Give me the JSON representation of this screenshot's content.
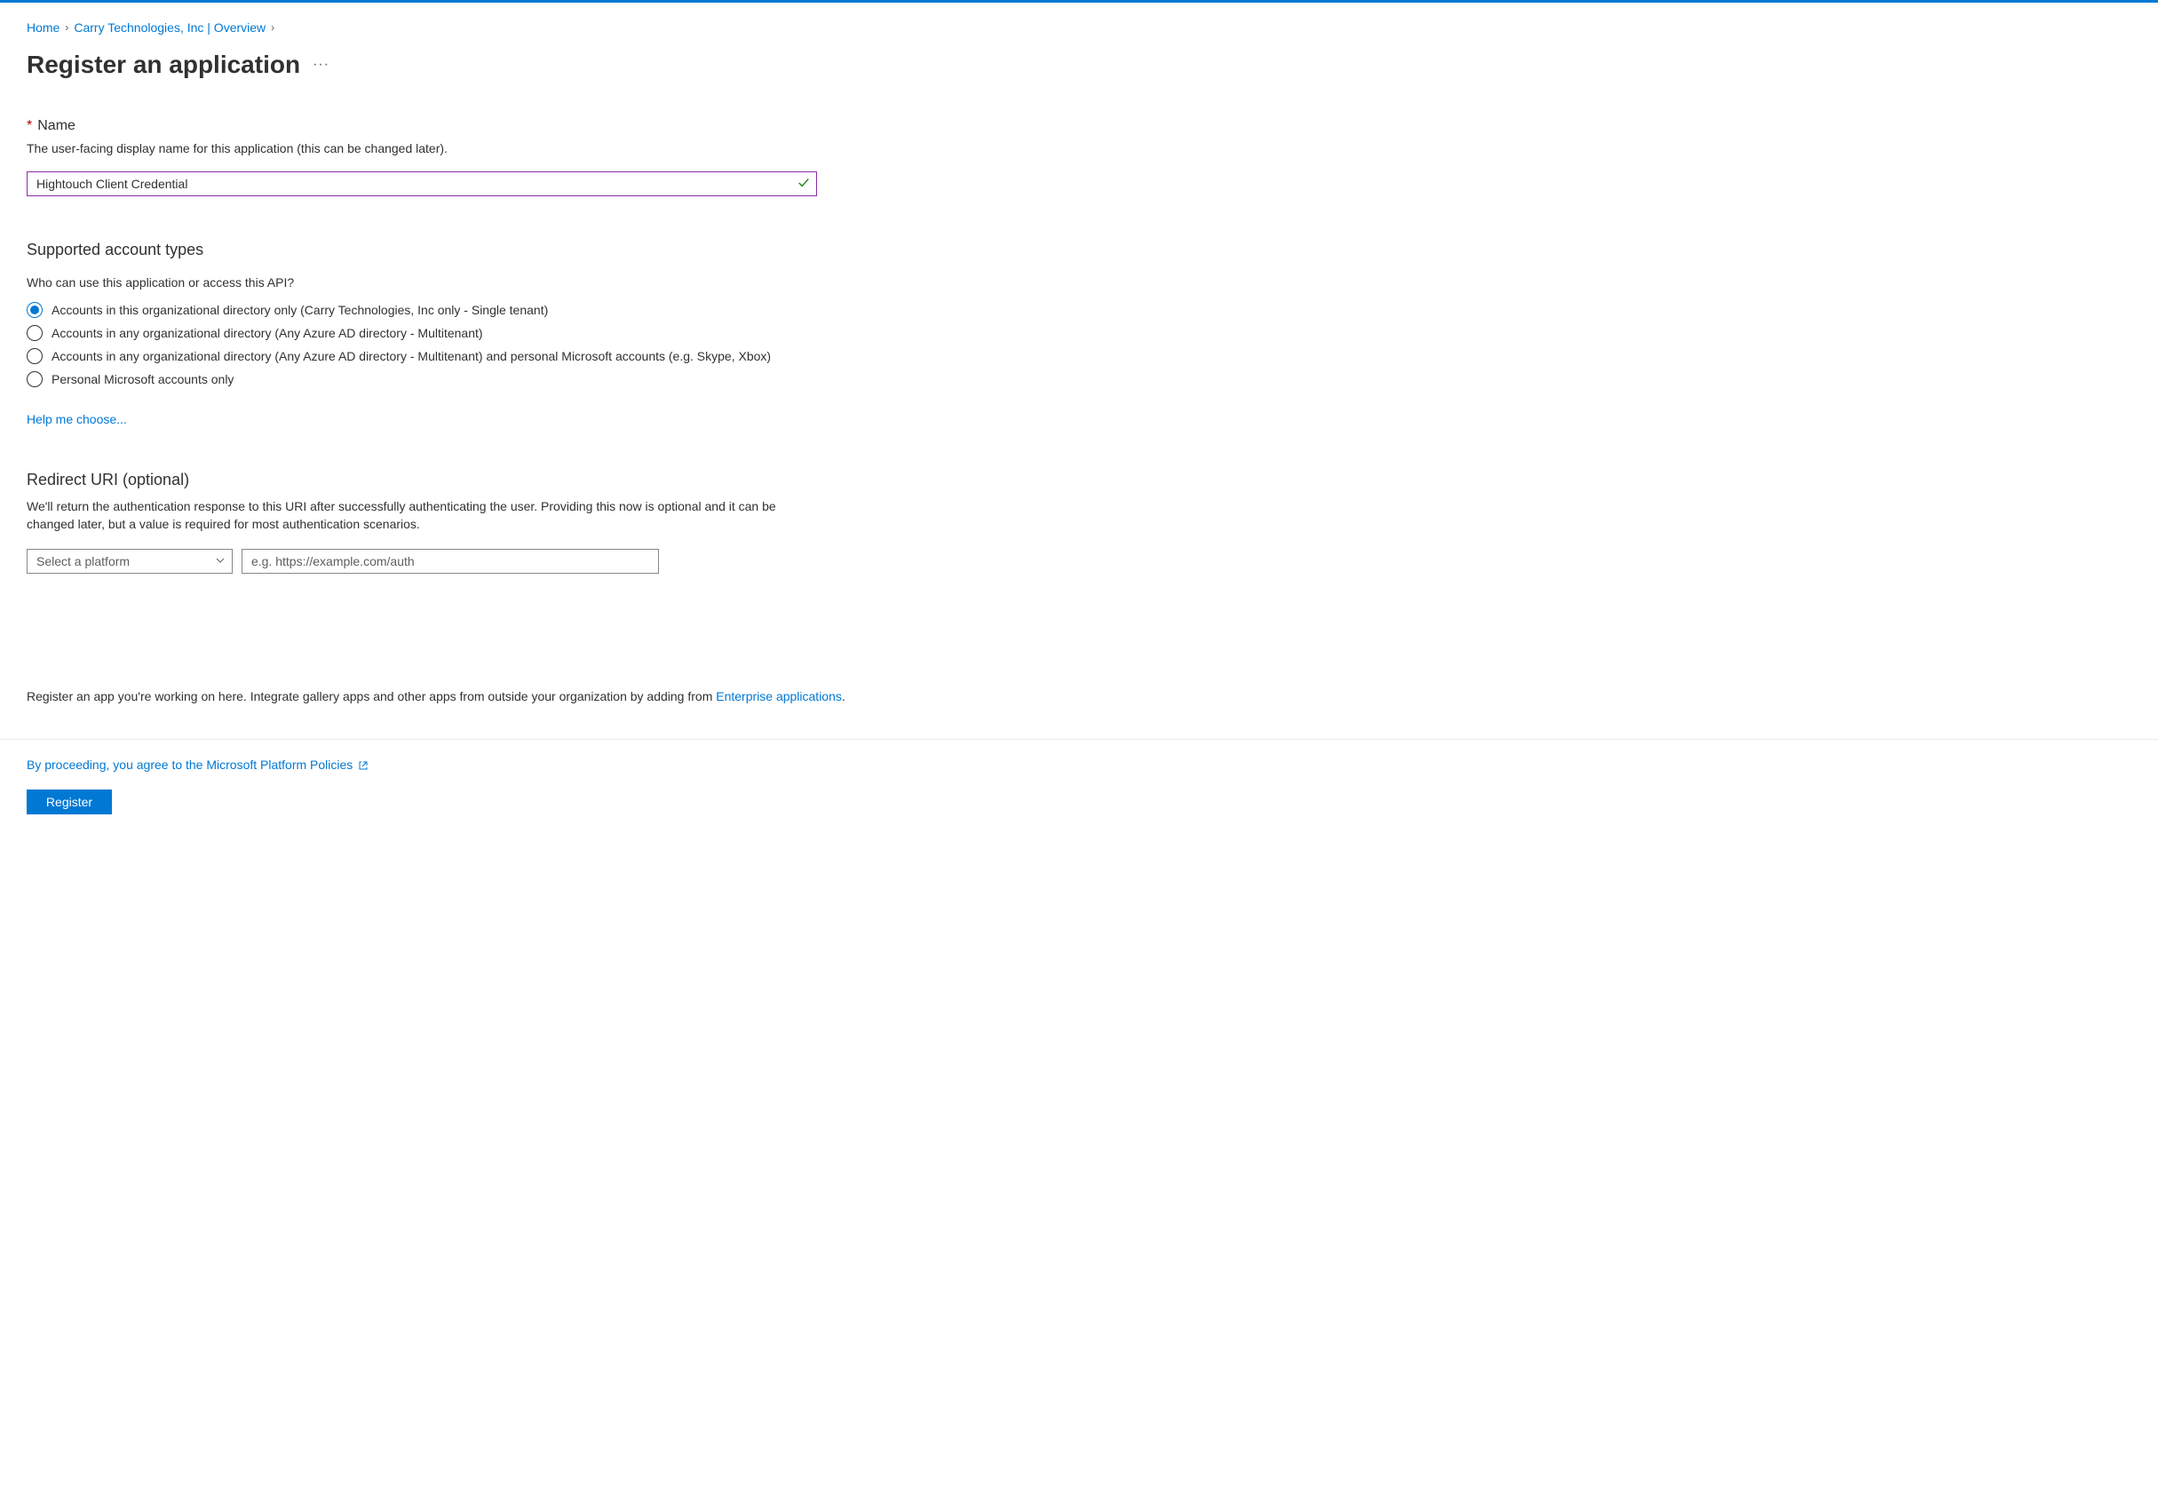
{
  "breadcrumb": {
    "home": "Home",
    "org": "Carry Technologies, Inc | Overview"
  },
  "page": {
    "title": "Register an application"
  },
  "name_section": {
    "label": "Name",
    "description": "The user-facing display name for this application (this can be changed later).",
    "value": "Hightouch Client Credential"
  },
  "account_types": {
    "heading": "Supported account types",
    "question": "Who can use this application or access this API?",
    "options": [
      "Accounts in this organizational directory only (Carry Technologies, Inc only - Single tenant)",
      "Accounts in any organizational directory (Any Azure AD directory - Multitenant)",
      "Accounts in any organizational directory (Any Azure AD directory - Multitenant) and personal Microsoft accounts (e.g. Skype, Xbox)",
      "Personal Microsoft accounts only"
    ],
    "help_link": "Help me choose..."
  },
  "redirect": {
    "heading": "Redirect URI (optional)",
    "description": "We'll return the authentication response to this URI after successfully authenticating the user. Providing this now is optional and it can be changed later, but a value is required for most authentication scenarios.",
    "platform_placeholder": "Select a platform",
    "uri_placeholder": "e.g. https://example.com/auth"
  },
  "footer": {
    "note_prefix": "Register an app you're working on here. Integrate gallery apps and other apps from outside your organization by adding from ",
    "note_link": "Enterprise applications",
    "note_suffix": ".",
    "policy_text": "By proceeding, you agree to the Microsoft Platform Policies",
    "register_button": "Register"
  }
}
